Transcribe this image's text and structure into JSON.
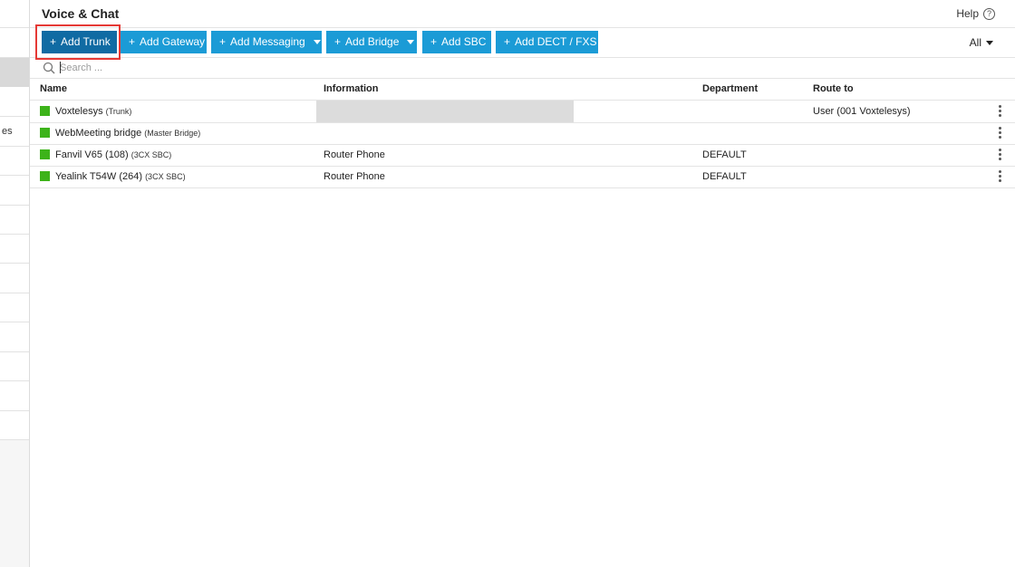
{
  "header": {
    "title": "Voice & Chat",
    "help_label": "Help",
    "help_icon": "question-circle-icon"
  },
  "sidebar": {
    "partial_label": "es"
  },
  "toolbar": {
    "buttons": [
      {
        "label": "Add Trunk",
        "plus": "+"
      },
      {
        "label": "Add Gateway",
        "plus": "+"
      },
      {
        "label": "Add Messaging",
        "plus": "+"
      },
      {
        "label": "Add Bridge",
        "plus": "+"
      },
      {
        "label": "Add SBC",
        "plus": "+"
      },
      {
        "label": "Add DECT / FXS",
        "plus": "+"
      }
    ],
    "filter_label": "All"
  },
  "search": {
    "placeholder": "Search ..."
  },
  "table": {
    "columns": [
      "Name",
      "Information",
      "Department",
      "Route to"
    ],
    "rows": [
      {
        "name": "Voxtelesys",
        "type": "(Trunk)",
        "information": "",
        "department": "",
        "route_to": "User (001 Voxtelesys)",
        "status_color": "#3db31a"
      },
      {
        "name": "WebMeeting bridge",
        "type": "(Master Bridge)",
        "information": "",
        "department": "",
        "route_to": "",
        "status_color": "#3db31a"
      },
      {
        "name": "Fanvil V65 (108)",
        "type": "(3CX SBC)",
        "information": "Router Phone",
        "department": "DEFAULT",
        "route_to": "",
        "status_color": "#3db31a"
      },
      {
        "name": "Yealink T54W (264)",
        "type": "(3CX SBC)",
        "information": "Router Phone",
        "department": "DEFAULT",
        "route_to": "",
        "status_color": "#3db31a"
      }
    ]
  },
  "colors": {
    "button_bg": "#1b9bd6",
    "button_active_bg": "#106ba3",
    "highlight_border": "#e53935",
    "status_green": "#3db31a"
  }
}
